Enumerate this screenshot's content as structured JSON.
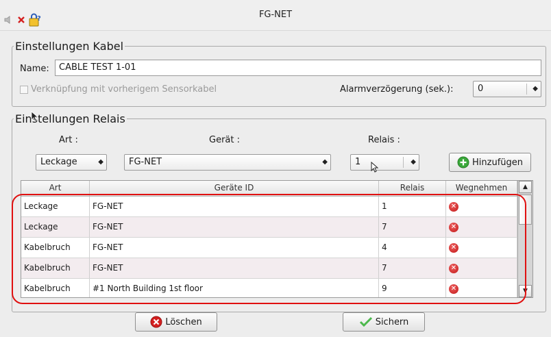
{
  "window": {
    "title": "FG-NET"
  },
  "titlebar_icons": [
    "speaker-mute-icon",
    "close-red-x-icon",
    "lock-help-icon"
  ],
  "cable_settings": {
    "legend": "Einstellungen Kabel",
    "name_label": "Name:",
    "name_value": "CABLE TEST 1-01",
    "link_checkbox_label": "Verknüpfung mit vorherigem Sensorkabel",
    "link_checked": false,
    "alarm_delay_label": "Alarmverzögerung (sek.):",
    "alarm_delay_value": "0"
  },
  "relay_settings": {
    "legend": "Einstellungen Relais",
    "art_label": "Art :",
    "geraet_label": "Gerät :",
    "relais_label": "Relais :",
    "art_value": "Leckage",
    "geraet_value": "FG-NET",
    "relais_value": "1",
    "add_button": "Hinzufügen"
  },
  "table": {
    "columns": [
      "Art",
      "Geräte ID",
      "Relais",
      "Wegnehmen"
    ],
    "rows": [
      {
        "art": "Leckage",
        "geraet_id": "FG-NET",
        "relais": "1"
      },
      {
        "art": "Leckage",
        "geraet_id": "FG-NET",
        "relais": "7"
      },
      {
        "art": "Kabelbruch",
        "geraet_id": "FG-NET",
        "relais": "4"
      },
      {
        "art": "Kabelbruch",
        "geraet_id": "FG-NET",
        "relais": "7"
      },
      {
        "art": "Kabelbruch",
        "geraet_id": "#1 North Building 1st floor",
        "relais": "9"
      }
    ]
  },
  "footer": {
    "delete_button": "Löschen",
    "save_button": "Sichern"
  },
  "colors": {
    "highlight": "#e01010",
    "delete_icon": "#d42020",
    "add_icon": "#3aa83a",
    "save_icon": "#4cb84c"
  }
}
